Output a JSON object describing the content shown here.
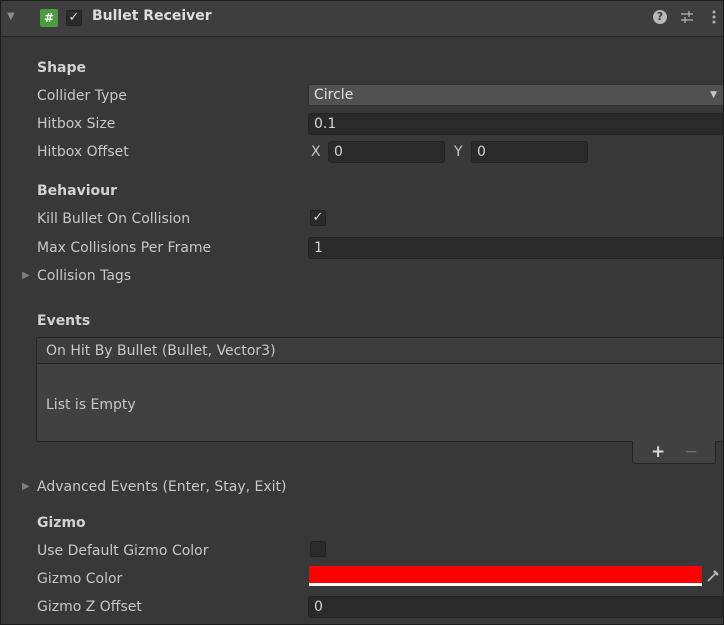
{
  "header": {
    "component_title": "Bullet Receiver",
    "enabled": true,
    "script_icon": "script-hash-icon",
    "help_icon": "help-icon",
    "presets_icon": "presets-icon",
    "menu_icon": "kebab-menu-icon"
  },
  "shape": {
    "section_label": "Shape",
    "collider_type_label": "Collider Type",
    "collider_type_value": "Circle",
    "hitbox_size_label": "Hitbox Size",
    "hitbox_size_value": "0.1",
    "hitbox_offset_label": "Hitbox Offset",
    "offset_x_label": "X",
    "offset_x_value": "0",
    "offset_y_label": "Y",
    "offset_y_value": "0"
  },
  "behaviour": {
    "section_label": "Behaviour",
    "kill_bullet_label": "Kill Bullet On Collision",
    "kill_bullet_checked": true,
    "max_collisions_label": "Max Collisions Per Frame",
    "max_collisions_value": "1",
    "collision_tags_label": "Collision Tags"
  },
  "events": {
    "section_label": "Events",
    "event_name": "On Hit By Bullet (Bullet, Vector3)",
    "empty_text": "List is Empty",
    "add_symbol": "+",
    "remove_symbol": "−",
    "advanced_events_label": "Advanced Events (Enter, Stay, Exit)"
  },
  "gizmo": {
    "section_label": "Gizmo",
    "use_default_label": "Use Default Gizmo Color",
    "use_default_checked": false,
    "gizmo_color_label": "Gizmo Color",
    "gizmo_color_value": "#ff0000",
    "gizmo_z_offset_label": "Gizmo Z Offset",
    "gizmo_z_offset_value": "0"
  },
  "colors": {
    "panel_bg": "#383838",
    "field_bg": "#2a2a2a",
    "checkbox_accent": "#4a9c3e"
  }
}
